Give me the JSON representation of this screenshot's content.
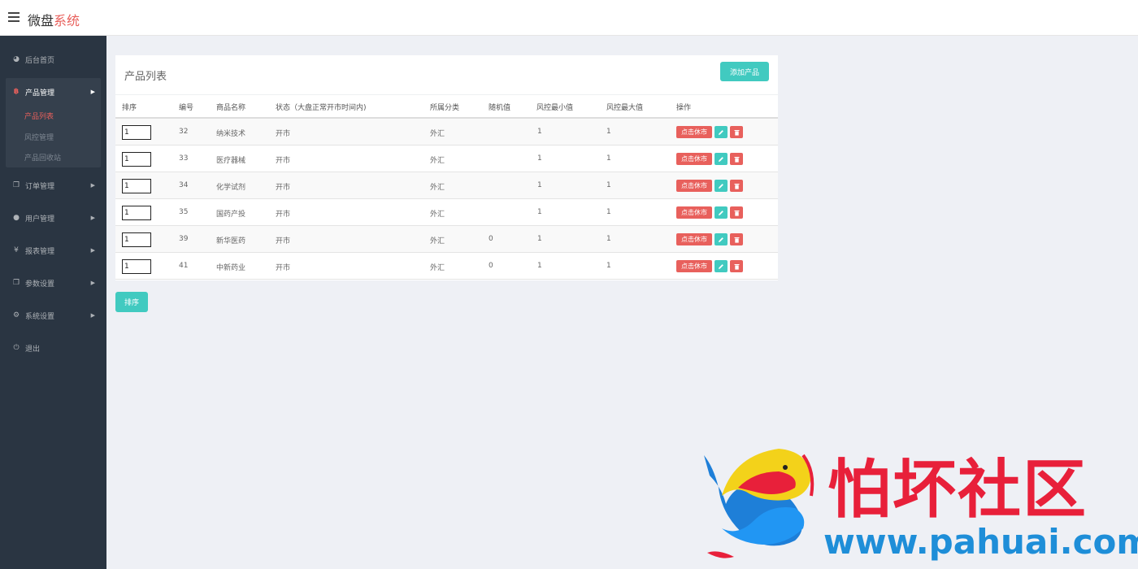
{
  "header": {
    "brand_part1": "微盘",
    "brand_part2": "系统"
  },
  "sidebar": {
    "items": [
      {
        "label": "后台首页",
        "icon": "dashboard-icon"
      },
      {
        "label": "产品管理",
        "icon": "bitcoin-icon"
      },
      {
        "label": "订单管理",
        "icon": "copy-icon"
      },
      {
        "label": "用户管理",
        "icon": "user-icon"
      },
      {
        "label": "报表管理",
        "icon": "yen-icon"
      },
      {
        "label": "参数设置",
        "icon": "copy-icon"
      },
      {
        "label": "系统设置",
        "icon": "gears-icon"
      },
      {
        "label": "退出",
        "icon": "power-icon"
      }
    ],
    "sub_items": [
      "产品列表",
      "风控管理",
      "产品回收站"
    ]
  },
  "panel": {
    "title": "产品列表",
    "add_button": "添加产品",
    "columns": [
      "排序",
      "编号",
      "商品名称",
      "状态（大盘正常开市时间内)",
      "所属分类",
      "随机值",
      "风控最小值",
      "风控最大值",
      "操作"
    ],
    "rows": [
      {
        "sort": "1",
        "id": "32",
        "name": "纳米技术",
        "status": "开市",
        "category": "外汇",
        "random": "",
        "min": "1",
        "max": "1"
      },
      {
        "sort": "1",
        "id": "33",
        "name": "医疗器械",
        "status": "开市",
        "category": "外汇",
        "random": "",
        "min": "1",
        "max": "1"
      },
      {
        "sort": "1",
        "id": "34",
        "name": "化学试剂",
        "status": "开市",
        "category": "外汇",
        "random": "",
        "min": "1",
        "max": "1"
      },
      {
        "sort": "1",
        "id": "35",
        "name": "国药产投",
        "status": "开市",
        "category": "外汇",
        "random": "",
        "min": "1",
        "max": "1"
      },
      {
        "sort": "1",
        "id": "39",
        "name": "新华医药",
        "status": "开市",
        "category": "外汇",
        "random": "0",
        "min": "1",
        "max": "1"
      },
      {
        "sort": "1",
        "id": "41",
        "name": "中新药业",
        "status": "开市",
        "category": "外汇",
        "random": "0",
        "min": "1",
        "max": "1"
      }
    ],
    "rest_button": "点击休市"
  },
  "sort_button": "排序",
  "watermark": {
    "text": "怕坏社区",
    "url": "www.pahuai.com"
  },
  "colors": {
    "accent_red": "#e8605c",
    "accent_teal": "#41cac0",
    "sidebar_bg": "#2a3542",
    "page_bg": "#eef0f5"
  }
}
